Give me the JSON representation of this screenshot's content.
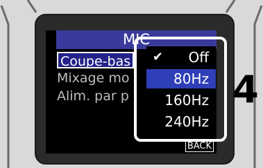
{
  "screen": {
    "title": "MIC",
    "menu_items": [
      {
        "label": "Coupe-bas",
        "selected": true
      },
      {
        "label": "Mixage mo",
        "selected": false
      },
      {
        "label": "Alim. par p",
        "selected": false
      }
    ],
    "back_label": "BACK"
  },
  "popup": {
    "options": [
      {
        "label": "Off",
        "checked": true,
        "highlighted": false
      },
      {
        "label": "80Hz",
        "checked": false,
        "highlighted": true
      },
      {
        "label": "160Hz",
        "checked": false,
        "highlighted": false
      },
      {
        "label": "240Hz",
        "checked": false,
        "highlighted": false
      }
    ],
    "check_icon": "checkmark-icon"
  },
  "callout": {
    "number": "4"
  },
  "colors": {
    "title_bar": "#3a3a9c",
    "highlight": "#2f3fb8",
    "device_body": "#d9d9d9",
    "bezel": "#2b2b2b"
  }
}
